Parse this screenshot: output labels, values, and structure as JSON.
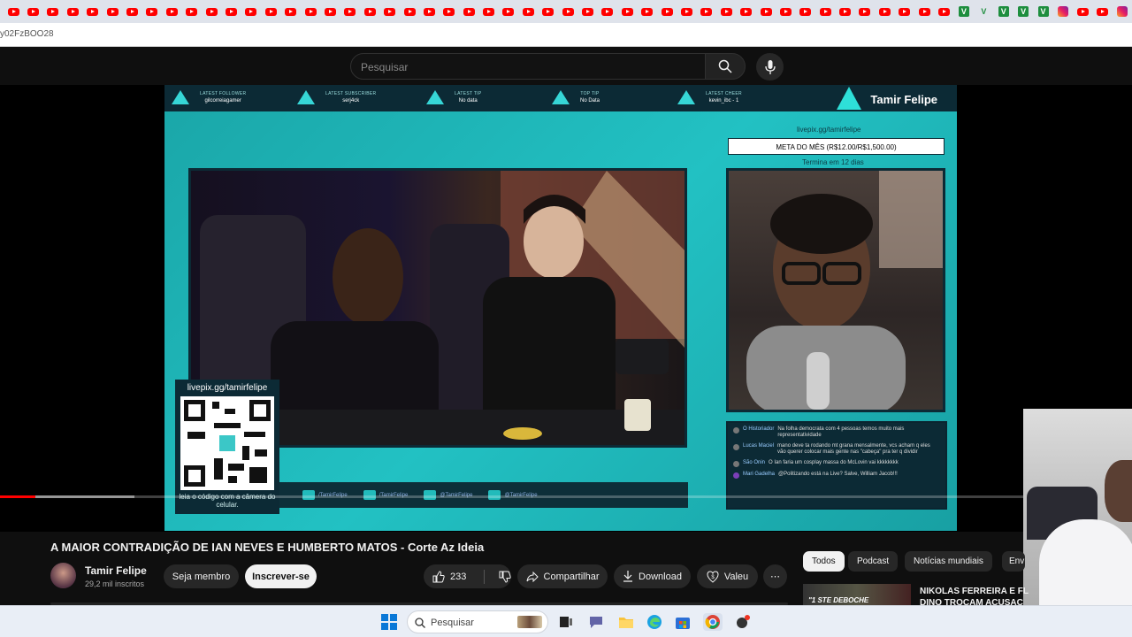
{
  "browser": {
    "address_text": "y02FzBOO28",
    "tabs": [
      "yt",
      "yt-alt",
      "yt",
      "yt",
      "yt",
      "yt",
      "yt",
      "yt",
      "yt",
      "yt",
      "yt",
      "yt",
      "yt",
      "yt",
      "yt",
      "yt",
      "yt",
      "yt",
      "yt",
      "yt",
      "yt",
      "yt",
      "yt",
      "yt",
      "yt",
      "yt",
      "yt",
      "yt",
      "yt",
      "yt",
      "yt",
      "yt",
      "yt",
      "yt",
      "yt",
      "yt",
      "yt",
      "yt",
      "yt",
      "yt",
      "yt",
      "yt",
      "yt",
      "yt",
      "yt",
      "yt",
      "yt",
      "yt",
      "gv",
      "gv-alt",
      "gv",
      "gv",
      "gv",
      "ig",
      "yt",
      "yt",
      "ig"
    ]
  },
  "header": {
    "search_placeholder": "Pesquisar"
  },
  "overlay": {
    "stats": [
      {
        "label": "LATEST FOLLOWER",
        "value": "gilcorreiagamer"
      },
      {
        "label": "LATEST SUBSCRIBER",
        "value": "serj4ck"
      },
      {
        "label": "LATEST TIP",
        "value": "No data"
      },
      {
        "label": "TOP TIP",
        "value": "No Data"
      },
      {
        "label": "LATEST CHEER",
        "value": "kevin_ibc - 1"
      }
    ],
    "brand": "Tamir Felipe",
    "livepix_top": "livepix.gg/tamirfelipe",
    "meta": "META DO MÊS (R$12.00/R$1,500.00)",
    "termina": "Termina em 12 dias",
    "qr_title": "livepix.gg/tamirfelipe",
    "qr_bottom": "leia o código com a câmera do celular.",
    "social": [
      "/TamirFelipe",
      "/TamirFelipe",
      "@TamirFelipe",
      "@TamirFelipe"
    ],
    "chat": [
      {
        "user": "O Historiador",
        "text": "Na folha democrata com 4 pessoas temos muito mais representatividade"
      },
      {
        "user": "Lucas Maciel",
        "text": "mano deve ta rodando mt grana mensalmente, vcs acham q eles vão querer colocar mais gente nas \"cabeça\" pra ter q dividir"
      },
      {
        "user": "São Onin",
        "text": "O Ian faria um cosplay massa do McLovin vai kkkkkkkk"
      },
      {
        "user": "Mari Gadelha",
        "text": "@Politizando está na Live? Salve, William Jacob!!!"
      }
    ]
  },
  "player": {
    "progress_played": 0.031,
    "progress_buffered": 0.119
  },
  "video": {
    "title": "A MAIOR CONTRADIÇÃO DE IAN NEVES E HUMBERTO MATOS - Corte Az Ideia",
    "channel": "Tamir Felipe",
    "subscribers": "29,2 mil inscritos",
    "member_label": "Seja membro",
    "subscribe_label": "Inscrever-se",
    "likes": "233",
    "share_label": "Compartilhar",
    "download_label": "Download",
    "thanks_label": "Valeu",
    "more_label": "⋯"
  },
  "chips": [
    "Todos",
    "Podcast",
    "Notícias mundiais",
    "Env"
  ],
  "suggestion": {
    "thumb_text": "\"1 STE DEBOCHE",
    "title": "NIKOLAS FERREIRA E FL",
    "title2": "DINO TROCAM ACUSAÇ"
  },
  "taskbar": {
    "search_placeholder": "Pesquisar"
  }
}
